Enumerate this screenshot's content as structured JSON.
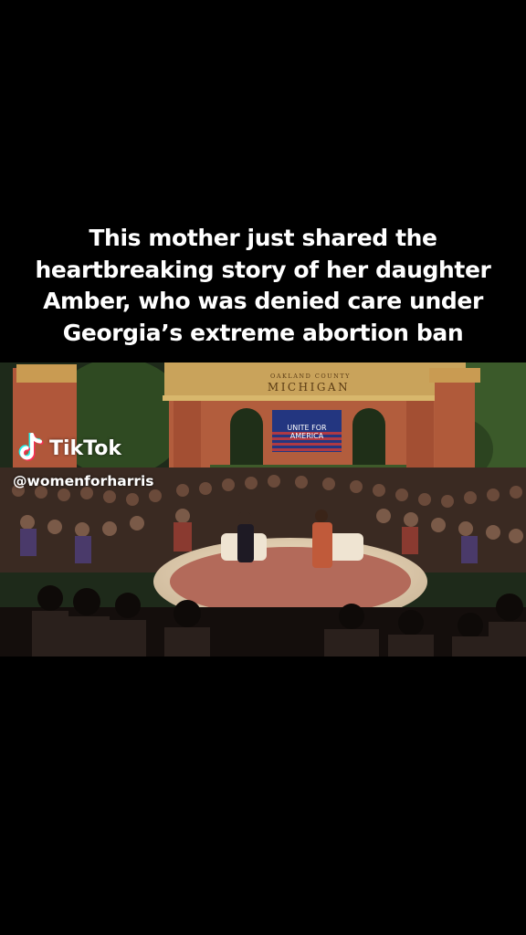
{
  "caption": {
    "lines": [
      "This mother just shared the",
      "heartbreaking story of her daughter",
      "Amber, who was denied care under",
      "Georgia’s extreme abortion ban"
    ]
  },
  "watermark": {
    "brand": "TikTok",
    "handle": "@womenforharris"
  },
  "scene": {
    "sign_county": "OAKLAND COUNTY",
    "sign_state": "MICHIGAN",
    "screen_line_1": "UNITE FOR",
    "screen_line_2": "AMERICA"
  },
  "colors": {
    "background": "#000000",
    "caption_text": "#ffffff",
    "tiktok_cyan": "#25f4ee",
    "tiktok_pink": "#fe2c55"
  },
  "icons": [
    "tiktok-logo-icon"
  ]
}
